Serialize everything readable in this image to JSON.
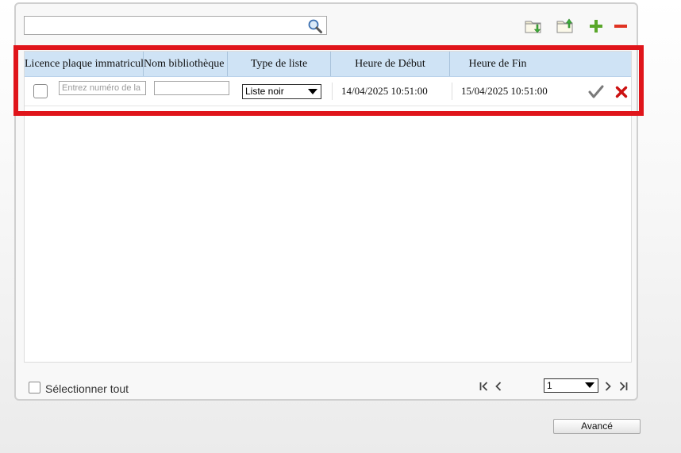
{
  "search": {
    "value": "",
    "placeholder": ""
  },
  "toolbar": {
    "import_icon": "folder-import-icon",
    "export_icon": "folder-export-icon",
    "add_icon": "plus-icon",
    "remove_icon": "minus-icon"
  },
  "table": {
    "columns": [
      "Licence plaque immatriculation",
      "Nom bibliothèque",
      "Type de liste",
      "Heure de Début",
      "Heure de Fin"
    ],
    "row": {
      "plate_placeholder": "Entrez numéro de la plaque",
      "library_value": "",
      "list_type": "Liste noir",
      "start": "14/04/2025 10:51:00",
      "end": "15/04/2025 10:51:00"
    }
  },
  "footer": {
    "select_all": "Sélectionner tout",
    "page": "1"
  },
  "advanced_button": "Avancé",
  "colors": {
    "header_bg": "#cfe3f5",
    "highlight": "#e0151b",
    "confirm": "#7a7a7a",
    "delete": "#cc1111",
    "add": "#5aa72a",
    "remove": "#e03322"
  }
}
